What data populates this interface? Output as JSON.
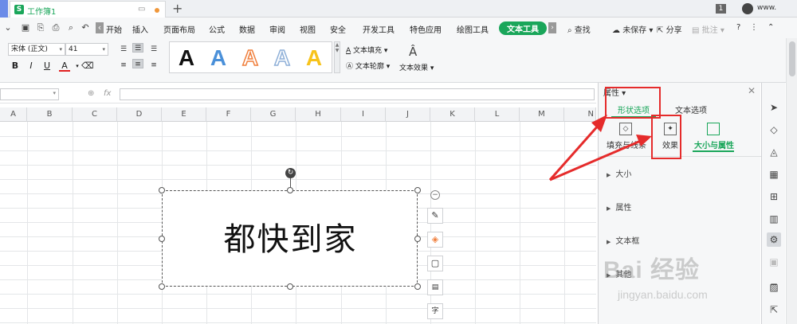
{
  "tabbar": {
    "doc_title": "工作簿1",
    "badge": "1",
    "user_name": "www."
  },
  "menu": {
    "items": [
      "开始",
      "插入",
      "页面布局",
      "公式",
      "数据",
      "审阅",
      "视图",
      "安全",
      "开发工具",
      "特色应用",
      "绘图工具",
      "文本工具"
    ],
    "active": "文本工具",
    "right_tools": [
      "查找",
      "未保存",
      "分享",
      "批注",
      "?"
    ]
  },
  "ribbon": {
    "font_name": "宋体 (正文)",
    "font_size": "41",
    "format_buttons": [
      "B",
      "I",
      "U",
      "A"
    ],
    "text_fill": "文本填充",
    "text_outline": "文本轮廓",
    "text_effect": "文本效果",
    "art_colors": [
      "#111111",
      "#4a90d9",
      "#f07f3c",
      "#8fb0d8",
      "#f7c31b"
    ]
  },
  "formula": {
    "fx": "fx"
  },
  "sheet": {
    "columns": [
      "A",
      "B",
      "C",
      "D",
      "E",
      "F",
      "G",
      "H",
      "I",
      "J",
      "K",
      "L",
      "M",
      "N"
    ]
  },
  "textbox": {
    "text": "都快到家"
  },
  "pane": {
    "title": "属性",
    "tabs": [
      "形状选项",
      "文本选项"
    ],
    "sub_tabs": [
      "填充与线条",
      "效果",
      "大小与属性"
    ],
    "sections": [
      "大小",
      "属性",
      "文本框",
      "其他"
    ]
  },
  "watermark": {
    "brand": "Bai 经验",
    "url": "jingyan.baidu.com"
  },
  "colors": {
    "accent": "#1aa65a",
    "annotation": "#e52b2b"
  }
}
